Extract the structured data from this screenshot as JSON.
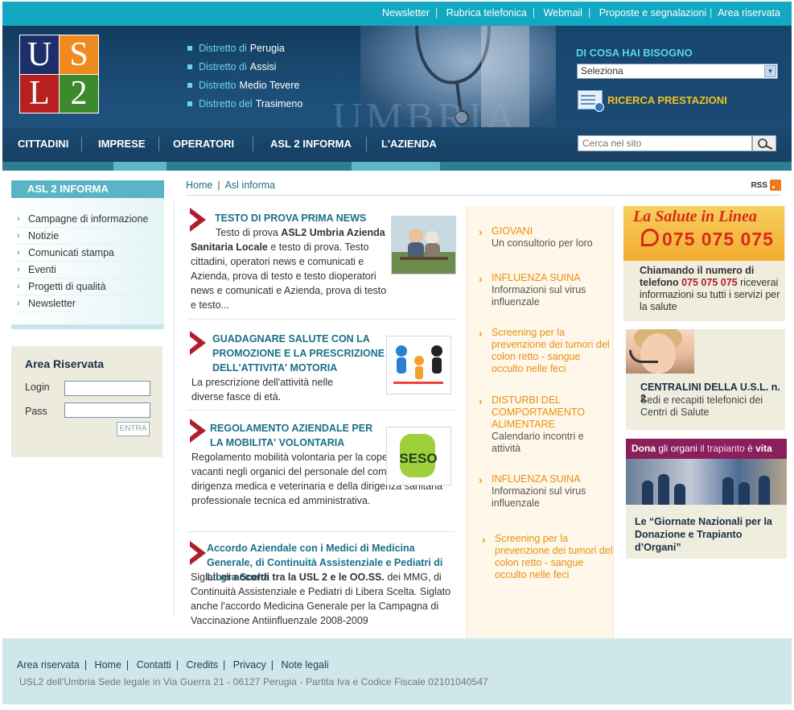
{
  "topbar": {
    "links": [
      "Newsletter",
      "Rubrica telefonica",
      "Webmail",
      "Proposte e segnalazioni",
      "Area riservata"
    ]
  },
  "header": {
    "logo": [
      "U",
      "S",
      "L",
      "2"
    ],
    "watermark": "UMBRIA",
    "districts": [
      {
        "prefix": "Distretto di",
        "name": "Perugia"
      },
      {
        "prefix": "Distretto di",
        "name": "Assisi"
      },
      {
        "prefix": "Distretto",
        "name": "Medio Tevere"
      },
      {
        "prefix": "Distretto del",
        "name": "Trasimeno"
      }
    ],
    "need_title": "DI COSA HAI BISOGNO",
    "need_select": "Seleziona",
    "ricerca": "RICERCA PRESTAZIONI"
  },
  "nav": {
    "items": [
      "CITTADINI",
      "IMPRESE",
      "OPERATORI",
      "ASL 2 INFORMA",
      "L'AZIENDA"
    ],
    "search_placeholder": "Cerca nel sito"
  },
  "left": {
    "title": "ASL 2 INFORMA",
    "menu": [
      "Campagne di informazione",
      "Notizie",
      "Comunicati stampa",
      "Eventi",
      "Progetti di qualità",
      "Newsletter"
    ],
    "login": {
      "title": "Area Riservata",
      "login_label": "Login",
      "pass_label": "Pass",
      "button": "ENTRA"
    }
  },
  "breadcrumb": {
    "items": [
      "Home",
      "Asl informa"
    ],
    "rss": "RSS"
  },
  "news": [
    {
      "title": "TESTO DI PROVA PRIMA NEWS",
      "body_pre": "Testo di prova ",
      "body_bold": "ASL2 Umbria Azienda Sanitaria Locale",
      "body_post": " e testo di  prova. Testo cittadini, operatori news e comunicati e Azienda, prova di testo e testo dioperatori news e comunicati e Azienda, prova di testo e testo..."
    },
    {
      "title": "GUADAGNARE SALUTE CON LA PROMOZIONE E LA PRESCRIZIONE DELL'ATTIVITA' MOTORIA",
      "body": "La prescrizione dell'attività nelle diverse fasce di età."
    },
    {
      "title": "REGOLAMENTO AZIENDALE PER LA MOBILITA' VOLONTARIA",
      "body": "Regolamento mobilità volontaria per la copertura di posti vacanti negli organici del personale del comparto e della dirigenza medica e veterinaria e della dirigenza sanitaria professionale tecnica ed amministrativa."
    },
    {
      "title": "Accordo Aziendale con i Medici di  Medicina Generale, di Continuità Assistenziale e Pediatri di Libera Scelta",
      "body_pre": "Siglati gli ",
      "body_bold": "accordi tra la USL 2 e le OO.SS.",
      "body_post": " dei MMG, di Continuità Assistenziale e Pediatri di Libera Scelta. Siglato anche l'accordo Medicina Generale per la Campagna di Vaccinazione Antiinfluenzale 2008-2009"
    }
  ],
  "news_thumb3_text": "SESO",
  "middle": [
    {
      "title": "GIOVANI",
      "desc": "Un consultorio per loro"
    },
    {
      "title": "INFLUENZA SUINA",
      "desc": "Informazioni sul virus influenzale"
    },
    {
      "title": "Screening per la prevenzione dei tumori del colon retto - sangue occulto nelle feci",
      "desc": ""
    },
    {
      "title": "DISTURBI DEL COMPORTAMENTO ALIMENTARE",
      "desc": "Calendario incontri e attività"
    },
    {
      "title": "INFLUENZA SUINA",
      "desc": "Informazioni sul virus influenzale"
    },
    {
      "title": "Screening per la prevenzione dei tumori del colon retto - sangue occulto nelle feci",
      "desc": ""
    }
  ],
  "right": {
    "banner1_title": "La Salute in Linea",
    "banner1_phone": "075 075 075",
    "box1_bold": "Chiamando il numero di telefono ",
    "box1_num": "075 075 075",
    "box1_rest": " riceverai  informazioni su tutti i ",
    "box1_link": "servizi per la salute",
    "box2_title": "CENTRALINI DELLA U.S.L. n. 2",
    "box2_desc": "Sedi e recapiti telefonici dei Centri di Salute",
    "box3_banner_a": "Dona",
    "box3_banner_b": " gli organi ",
    "box3_banner_c": "il trapianto",
    "box3_banner_d": " è ",
    "box3_banner_e": "vita",
    "box3_caption": "Le “Giornate Nazionali per la Donazione e Trapianto d’Organi”"
  },
  "footer": {
    "links": [
      "Area riservata",
      "Home",
      "Contatti",
      "Credits",
      "Privacy",
      "Note legali"
    ],
    "address": "USL2 dell'Umbria Sede legale in Via Guerra 21 - 06127 Perugia - Partita Iva e Codice Fiscale 02101040547"
  }
}
